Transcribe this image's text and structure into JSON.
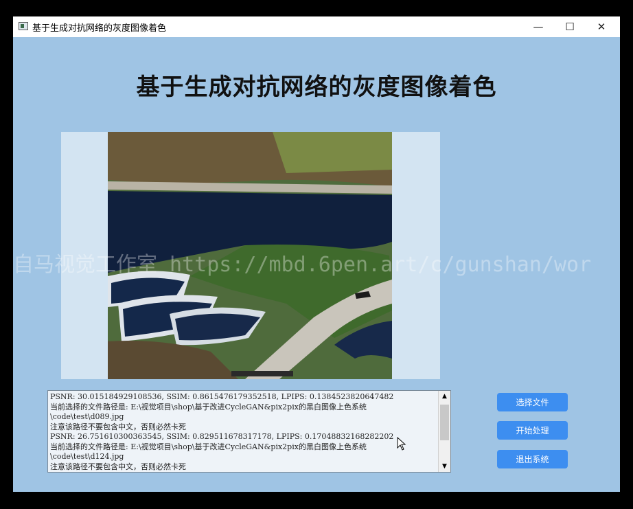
{
  "window": {
    "title": "基于生成对抗网络的灰度图像着色",
    "controls": {
      "minimize": "—",
      "maximize": "☐",
      "close": "✕"
    }
  },
  "main": {
    "heading": "基于生成对抗网络的灰度图像着色",
    "watermark": "自马视觉工作室 https://mbd.6pen.art/c/gunshan/wor"
  },
  "log": {
    "lines": [
      "PSNR: 30.015184929108536, SSIM: 0.8615476179352518, LPIPS: 0.1384523820647482",
      "当前选择的文件路径是: E:\\视觉项目\\shop\\基于改进CycleGAN&pix2pix的黑白图像上色系统",
      "\\code\\test\\d089.jpg",
      "注意该路径不要包含中文，否则必然卡死",
      "PSNR: 26.751610300363545, SSIM: 0.829511678317178, LPIPS: 0.17048832168282202",
      "当前选择的文件路径是: E:\\视觉项目\\shop\\基于改进CycleGAN&pix2pix的黑白图像上色系统",
      "\\code\\test\\d124.jpg",
      "注意该路径不要包含中文，否则必然卡死"
    ]
  },
  "buttons": {
    "select_file": "选择文件",
    "start_process": "开始处理",
    "exit": "退出系统"
  },
  "colors": {
    "background": "#9fc4e4",
    "button": "#3d8ef0",
    "image_panel": "#d3e4f2"
  }
}
